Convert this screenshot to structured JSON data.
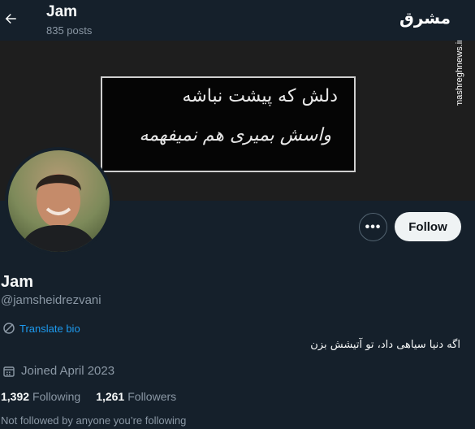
{
  "header": {
    "name": "Jam",
    "posts": "835 posts"
  },
  "watermark": {
    "logo_text": "مشرق",
    "site": "mashreghnews.ir"
  },
  "banner": {
    "line1": "دلش که پیشت نباشه",
    "line2": "واسش بمیری هم نمیفهمه"
  },
  "actions": {
    "more_label": "•••",
    "follow_label": "Follow"
  },
  "profile": {
    "display_name": "Jam",
    "handle": "@jamsheidrezvani",
    "translate_label": "Translate bio",
    "bio": "اگه دنیا سیاهی داد، تو آتیشش بزن",
    "joined": "Joined April 2023",
    "following_count": "1,392",
    "following_label": "Following",
    "followers_count": "1,261",
    "followers_label": "Followers",
    "not_followed_text": "Not followed by anyone you’re following"
  },
  "colors": {
    "background": "#15202b",
    "accent": "#1d9bf0",
    "secondary_text": "#8b98a5"
  }
}
